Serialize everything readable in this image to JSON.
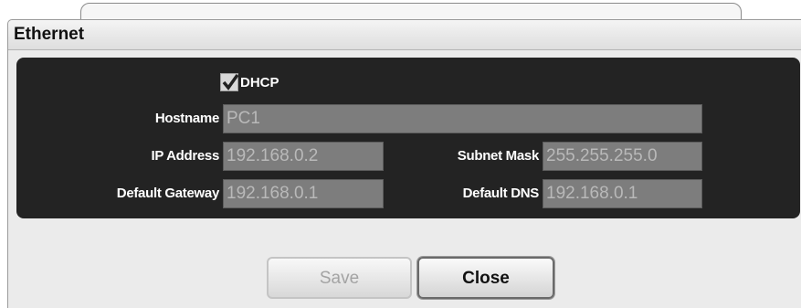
{
  "dialog": {
    "title": "Ethernet",
    "dhcp": {
      "label": "DHCP",
      "checked": true
    },
    "fields": {
      "hostname": {
        "label": "Hostname",
        "value": "PC1"
      },
      "ip_address": {
        "label": "IP Address",
        "value": "192.168.0.2"
      },
      "subnet_mask": {
        "label": "Subnet Mask",
        "value": "255.255.255.0"
      },
      "default_gateway": {
        "label": "Default Gateway",
        "value": "192.168.0.1"
      },
      "default_dns": {
        "label": "Default DNS",
        "value": "192.168.0.1"
      }
    },
    "buttons": {
      "save": "Save",
      "close": "Close"
    }
  },
  "colors": {
    "panel_background": "#232323",
    "field_background": "#7d7d7d",
    "field_text": "#b9b9b9",
    "label_text": "#ffffff"
  },
  "icons": {
    "dhcp_checkbox": "check-icon"
  }
}
